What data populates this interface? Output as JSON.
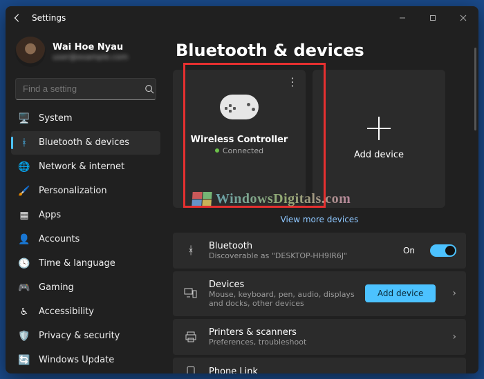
{
  "window": {
    "title": "Settings"
  },
  "user": {
    "name": "Wai Hoe Nyau",
    "email": "user@example.com"
  },
  "search": {
    "placeholder": "Find a setting"
  },
  "nav": [
    {
      "label": "System",
      "icon": "system-icon"
    },
    {
      "label": "Bluetooth & devices",
      "icon": "bluetooth-icon",
      "selected": true
    },
    {
      "label": "Network & internet",
      "icon": "network-icon"
    },
    {
      "label": "Personalization",
      "icon": "personalization-icon"
    },
    {
      "label": "Apps",
      "icon": "apps-icon"
    },
    {
      "label": "Accounts",
      "icon": "accounts-icon"
    },
    {
      "label": "Time & language",
      "icon": "time-icon"
    },
    {
      "label": "Gaming",
      "icon": "gaming-icon"
    },
    {
      "label": "Accessibility",
      "icon": "accessibility-icon"
    },
    {
      "label": "Privacy & security",
      "icon": "privacy-icon"
    },
    {
      "label": "Windows Update",
      "icon": "update-icon"
    }
  ],
  "page": {
    "heading": "Bluetooth & devices",
    "device_tile": {
      "name": "Wireless Controller",
      "status": "Connected",
      "status_color": "#6cc24a"
    },
    "add_tile": {
      "label": "Add device"
    },
    "view_more": "View more devices",
    "rows": {
      "bluetooth": {
        "title": "Bluetooth",
        "subtitle": "Discoverable as \"DESKTOP-HH9IR6J\"",
        "toggle_label": "On",
        "toggle_on": true
      },
      "devices": {
        "title": "Devices",
        "subtitle": "Mouse, keyboard, pen, audio, displays and docks, other devices",
        "button": "Add device"
      },
      "printers": {
        "title": "Printers & scanners",
        "subtitle": "Preferences, troubleshoot"
      },
      "phone": {
        "title": "Phone Link"
      }
    }
  },
  "watermark": "WindowsDigitals.com"
}
